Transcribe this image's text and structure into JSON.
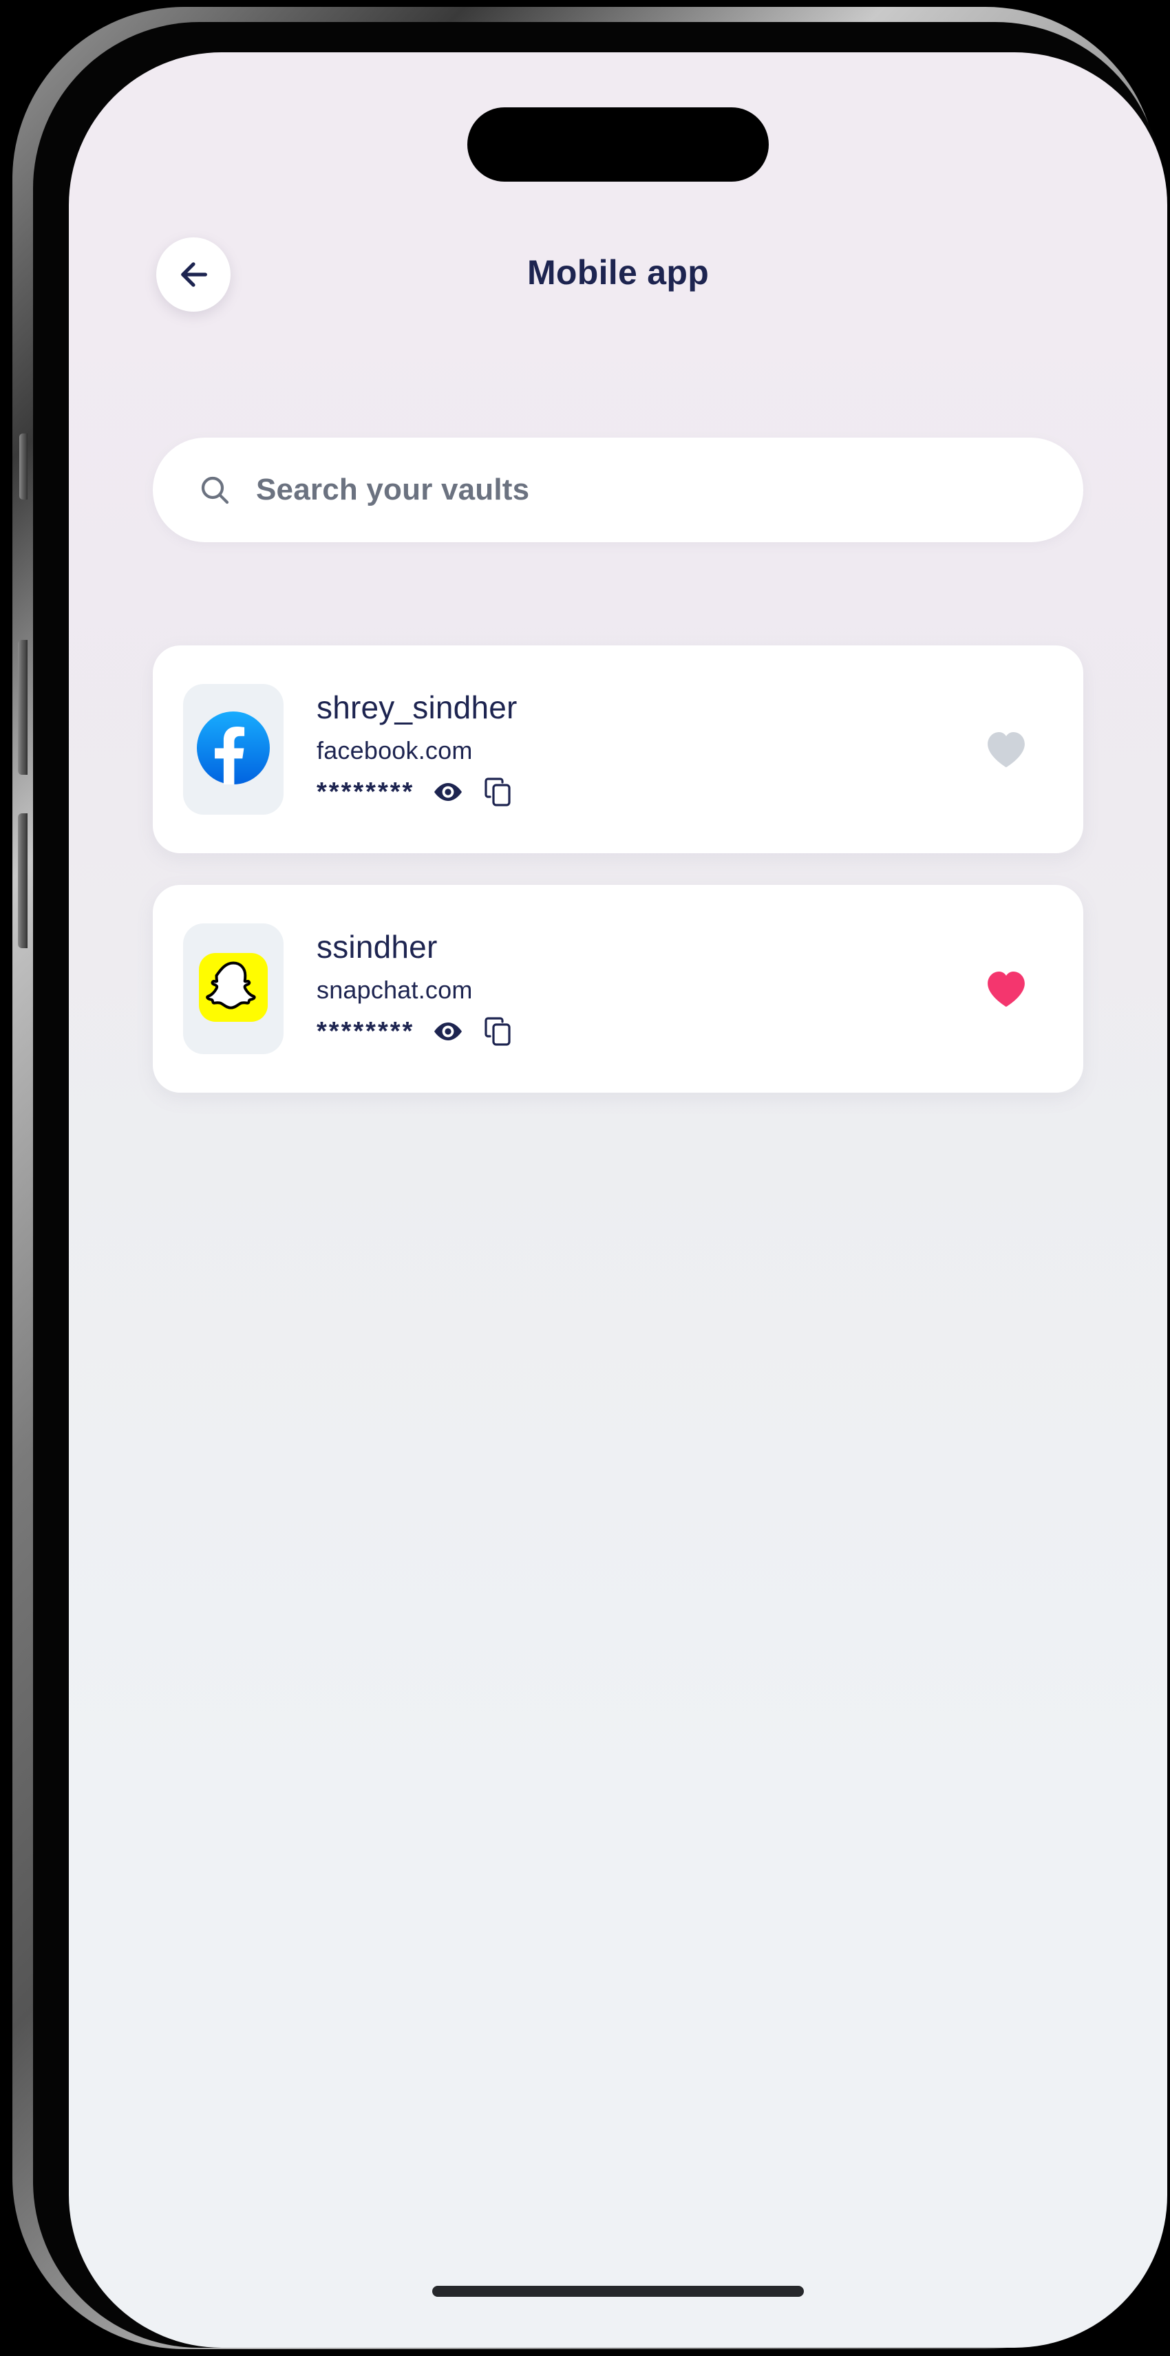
{
  "device": {
    "name": "smartphone-mockup",
    "dynamic_island": "dynamic-island",
    "home_indicator": "home-indicator",
    "buttons": {
      "silent_switch": "silent-switch",
      "volume_up": "volume-up-button",
      "volume_down": "volume-down-button",
      "power": "power-button"
    }
  },
  "screen": {
    "background_top": "#F1EBF2",
    "background_bottom": "#EFF2F5"
  },
  "header": {
    "title": "Mobile app",
    "back_icon": "arrow-left-icon",
    "title_color": "#1D2450"
  },
  "search": {
    "icon": "search-icon",
    "placeholder": "Search your vaults",
    "value": ""
  },
  "vaults": [
    {
      "username": "shrey_sindher",
      "site": "facebook.com",
      "password_mask": "********",
      "logo": "facebook-logo",
      "logo_color": "#1877F2",
      "favorite": false,
      "favorite_color": "#CED3DA",
      "reveal_icon": "eye-icon",
      "copy_icon": "copy-icon"
    },
    {
      "username": "ssindher",
      "site": "snapchat.com",
      "password_mask": "********",
      "logo": "snapchat-logo",
      "logo_color": "#FFFC00",
      "favorite": true,
      "favorite_color": "#F4366E",
      "reveal_icon": "eye-icon",
      "copy_icon": "copy-icon"
    }
  ],
  "colors": {
    "navy": "#1D2450",
    "heart_active": "#F4366E",
    "heart_inactive": "#CED3DA",
    "card_bg": "#FFFFFF",
    "logo_tile_bg": "#EDF1F5"
  }
}
